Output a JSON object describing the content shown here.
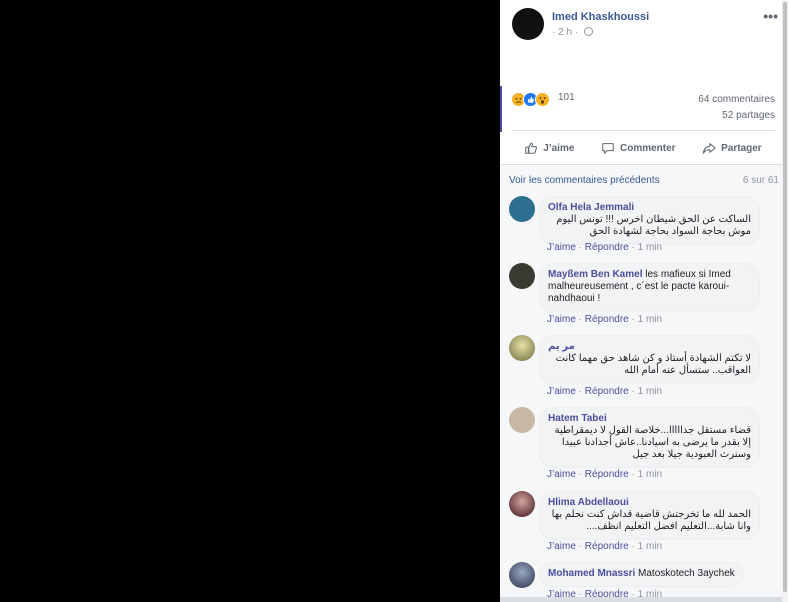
{
  "post": {
    "author": "Imed Khaskhoussi",
    "time": "· 2 h ·",
    "more_icon": "•••",
    "reaction_count": "101",
    "comments_count": "64 commentaires",
    "shares_count": "52 partages",
    "actions": {
      "like": "J’aime",
      "comment": "Commenter",
      "share": "Partager"
    }
  },
  "comments_section": {
    "previous_link": "Voir les commentaires précédents",
    "position": "6 sur 61",
    "comments": [
      {
        "name": "Olfa Hela Jemmali",
        "text": "الساكت عن الحق شيطان اخرس !!! تونس اليوم موش بحاجة السواد بحاجة لشهادة الحق",
        "rtl": true,
        "like": "J’aime",
        "reply": "Répondre",
        "time": "1 min",
        "avatar_color": "#2d6f8f"
      },
      {
        "name": "Mayßem Ben Kamel",
        "text": "les mafieux si Imed malheureusement , c´est le pacte karoui-nahdhaoui !",
        "rtl": false,
        "like": "J’aime",
        "reply": "Répondre",
        "time": "1 min",
        "avatar_color": "#3a3a32"
      },
      {
        "name": "مر يم",
        "text": "لا تكتم الشهادة أستاذ و كن شاهد حق مهما كانت العواقب.. ستسأل عنه أمام الله",
        "rtl": true,
        "like": "J’aime",
        "reply": "Répondre",
        "time": "1 min",
        "avatar_color": "#8a8a4e"
      },
      {
        "name": "Hatem Tabei",
        "text": "قضاء مستقل جدااااا...خلاصة القول لا ديمقراطية إلا بقدر ما يرضى به اسيادنا..عاش أجدادنا عبيدا وسنرث العبودية جيلا بعد جيل",
        "rtl": true,
        "like": "J’aime",
        "reply": "Répondre",
        "time": "1 min",
        "avatar_color": "#c9b8a6"
      },
      {
        "name": "Hlima Abdellaoui",
        "text": "الحمد لله ما تخرجتش قاضية قداش كنت نحلم بها وانا شابة...التعليم افضل التعليم انظف....",
        "rtl": true,
        "like": "J’aime",
        "reply": "Répondre",
        "time": "1 min",
        "avatar_color": "#5a1f2a"
      },
      {
        "name": "Mohamed Mnassri",
        "text": "Matoskotech 3aychek",
        "rtl": false,
        "like": "J’aime",
        "reply": "Répondre",
        "time": "1 min",
        "avatar_color": "#4c5a78"
      }
    ]
  },
  "colors": {
    "link": "#385898",
    "name": "#4b4f9c",
    "muted": "#90949c",
    "like_blue": "#2078f4",
    "emoji_yellow": "#f7b125"
  },
  "icons": [
    "more-icon",
    "globe-icon",
    "sad-reaction-icon",
    "like-reaction-icon",
    "wow-reaction-icon",
    "thumbs-up-icon",
    "comment-icon",
    "share-icon"
  ]
}
